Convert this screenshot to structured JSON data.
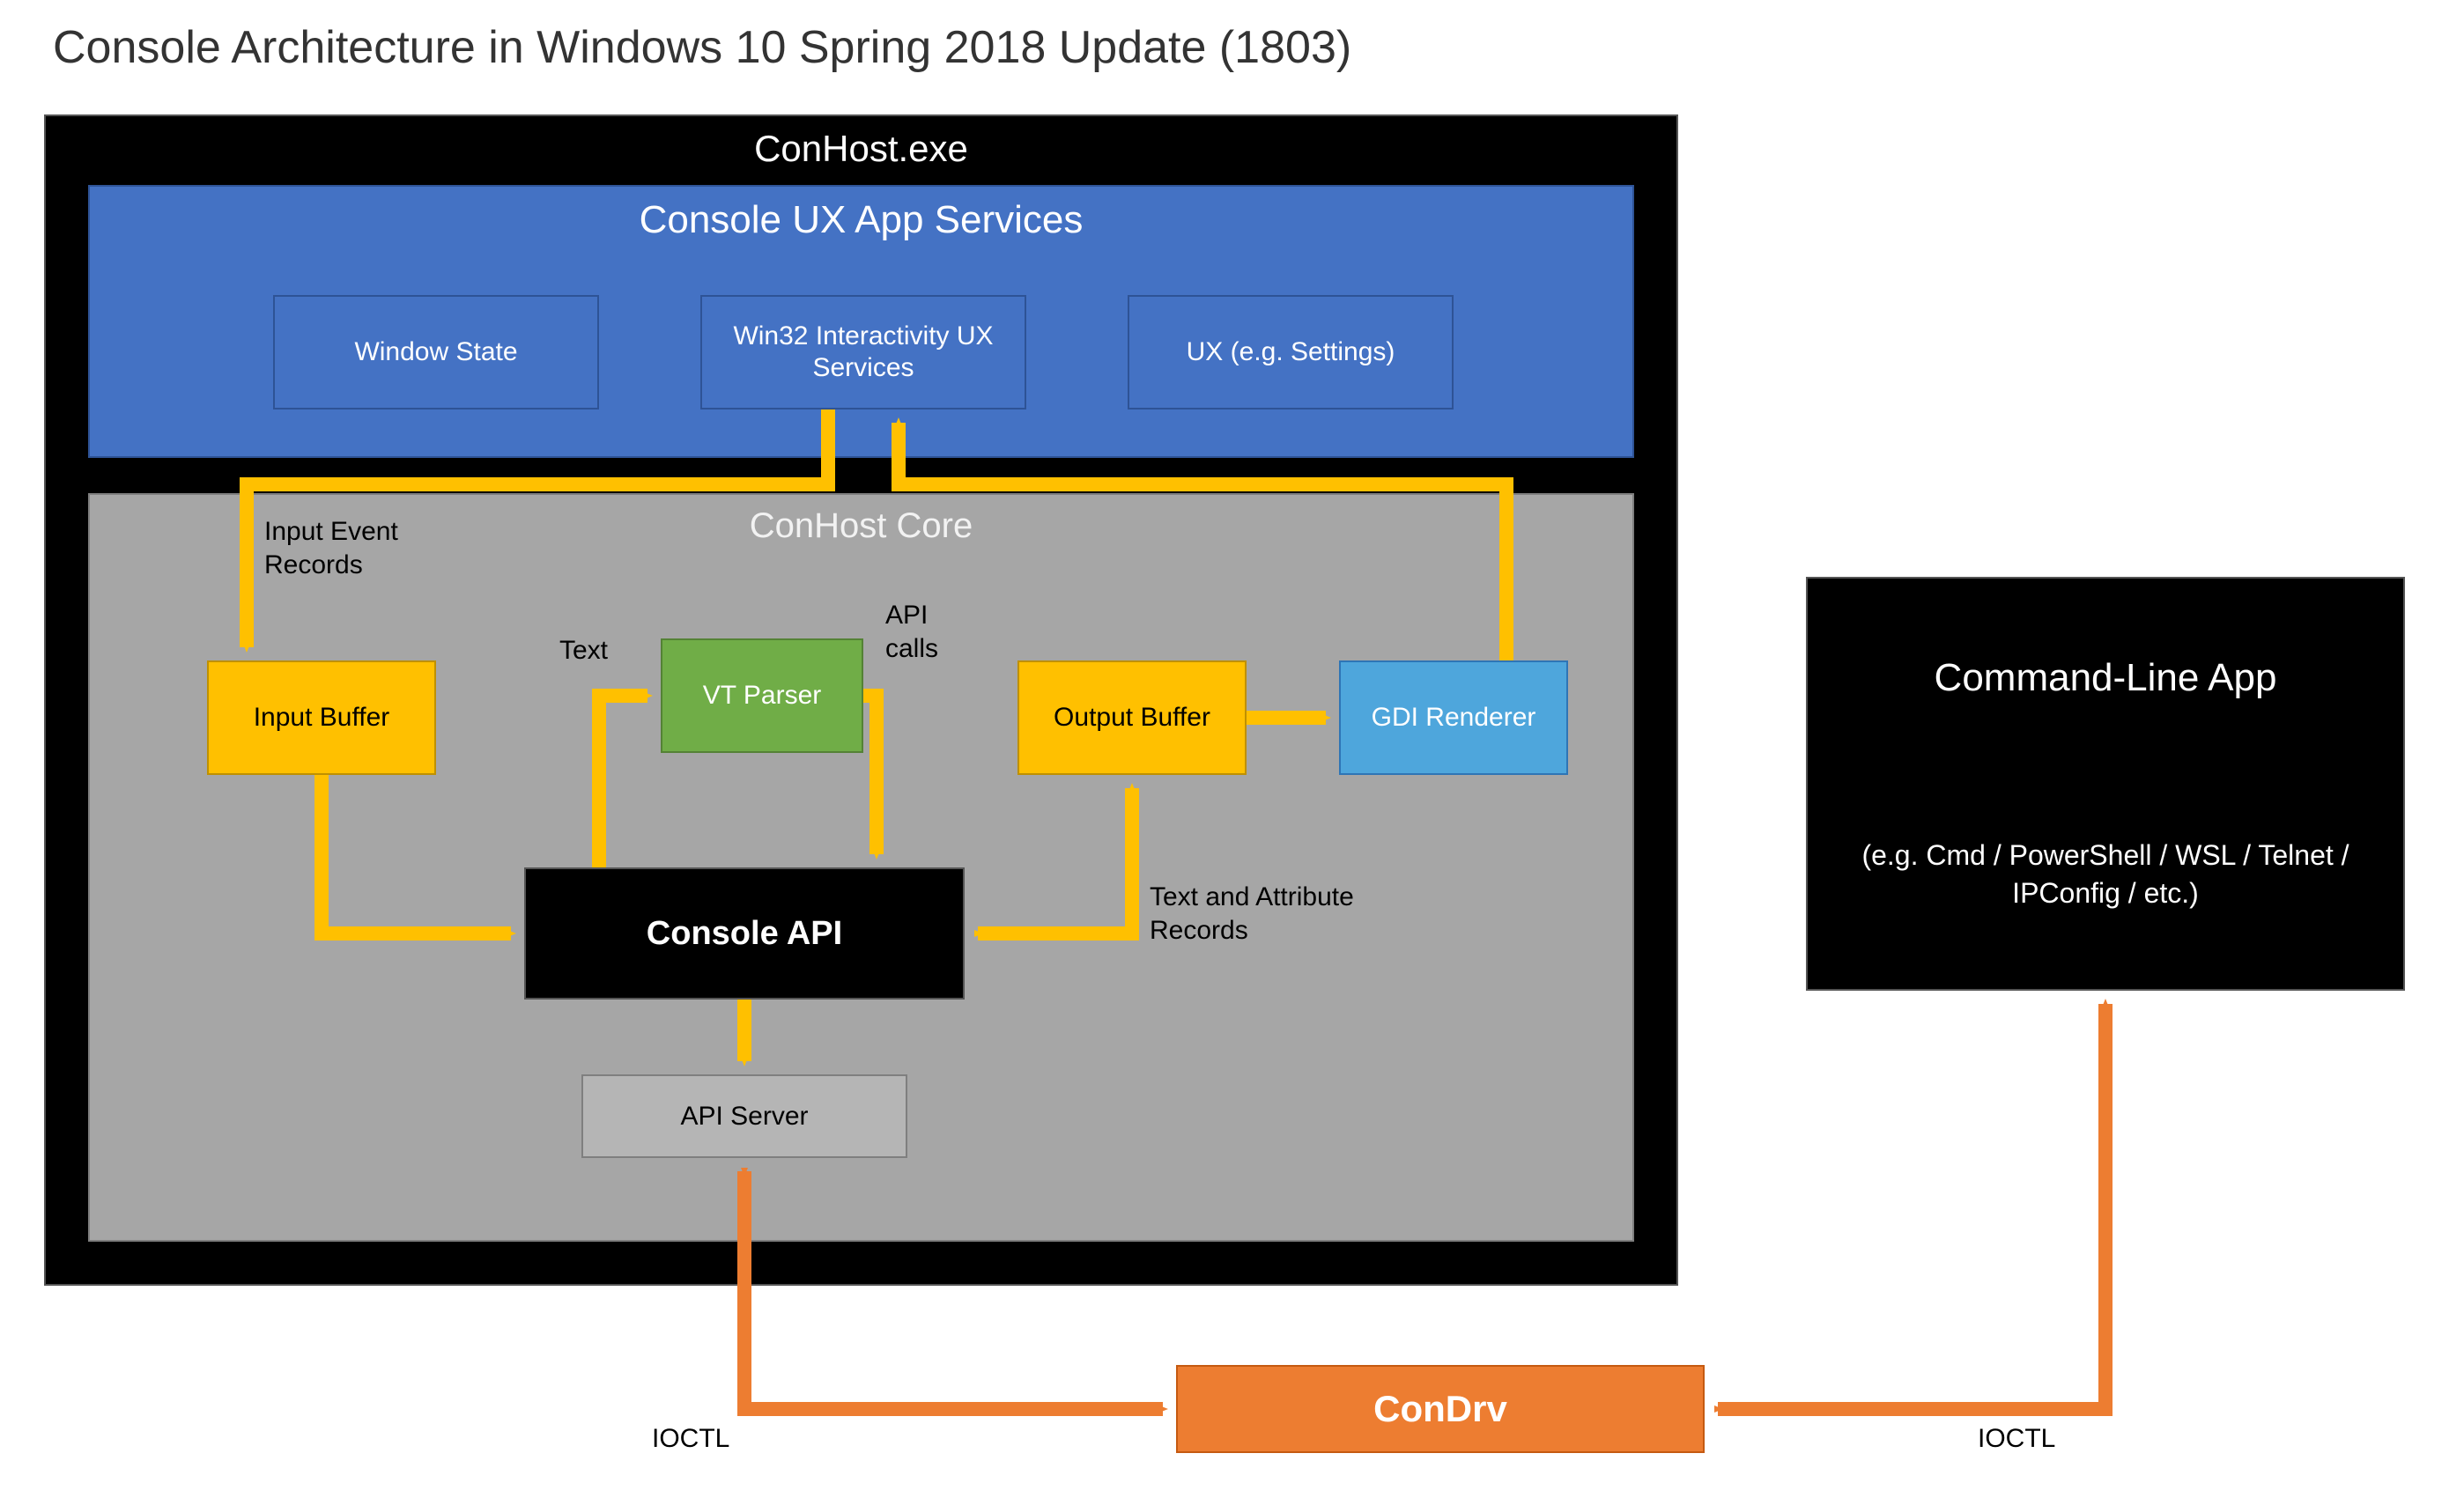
{
  "title": "Console Architecture in Windows 10 Spring 2018 Update (1803)",
  "conhost": {
    "exe_title": "ConHost.exe",
    "ux_title": "Console UX App Services",
    "ux_boxes": {
      "window_state": "Window State",
      "interactivity": "Win32 Interactivity UX Services",
      "ux_settings": "UX (e.g. Settings)"
    },
    "core_title": "ConHost Core",
    "core_boxes": {
      "input_buffer": "Input Buffer",
      "vt_parser": "VT Parser",
      "output_buffer": "Output Buffer",
      "gdi_renderer": "GDI Renderer",
      "console_api": "Console API",
      "api_server": "API Server"
    }
  },
  "app": {
    "title": "Command-Line App",
    "subtitle": "(e.g. Cmd / PowerShell / WSL / Telnet / IPConfig / etc.)"
  },
  "condrv": "ConDrv",
  "edge_labels": {
    "input_event_records": "Input Event Records",
    "text": "Text",
    "api_calls": "API calls",
    "text_attr_records": "Text and Attribute Records",
    "ioctl_left": "IOCTL",
    "ioctl_right": "IOCTL"
  },
  "colors": {
    "arrow_yellow": "#ffc000",
    "arrow_orange": "#ed7d31"
  }
}
